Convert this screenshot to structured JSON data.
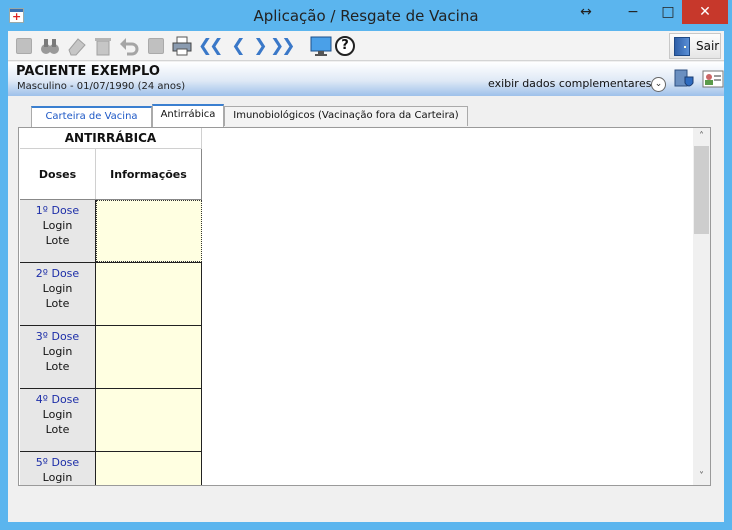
{
  "window": {
    "title": "Aplicação / Resgate de Vacina",
    "controls": {
      "restore": "↔",
      "minimize": "−",
      "maximize": "□",
      "close": "✕"
    }
  },
  "toolbar": {
    "buttons": [
      {
        "name": "new-icon",
        "glyph": ""
      },
      {
        "name": "search-binoculars-icon",
        "glyph": ""
      },
      {
        "name": "eraser-icon",
        "glyph": ""
      },
      {
        "name": "trash-icon",
        "glyph": ""
      },
      {
        "name": "undo-icon",
        "glyph": ""
      },
      {
        "name": "save-icon",
        "glyph": ""
      },
      {
        "name": "print-icon",
        "glyph": ""
      }
    ],
    "nav": {
      "first": "❮❮",
      "prev": "❮",
      "next": "❯",
      "last": "❯❯"
    },
    "help": "?",
    "exit_label": "Sair"
  },
  "patient": {
    "name": "PACIENTE EXEMPLO",
    "info": "Masculino - 01/07/1990 (24 anos)",
    "extra_link": "exibir dados complementares...",
    "expand_glyph": "⌄"
  },
  "tabs": [
    {
      "label": "Carteira de Vacina"
    },
    {
      "label": "Antirrábica"
    },
    {
      "label": "Imunobiológicos (Vacinação fora da Carteira)"
    }
  ],
  "grid": {
    "title": "ANTIRRÁBICA",
    "columns": [
      "Doses",
      "Informações"
    ],
    "rows": [
      {
        "dose": "1º Dose",
        "login": "Login",
        "lote": "Lote"
      },
      {
        "dose": "2º Dose",
        "login": "Login",
        "lote": "Lote"
      },
      {
        "dose": "3º Dose",
        "login": "Login",
        "lote": "Lote"
      },
      {
        "dose": "4º Dose",
        "login": "Login",
        "lote": "Lote"
      },
      {
        "dose": "5º Dose",
        "login": "Login",
        "lote": ""
      }
    ]
  },
  "scrollbar": {
    "up": "˄",
    "down": "˅"
  },
  "colors": {
    "accent": "#3a7fd0",
    "cell_fill": "#ffffe1",
    "dose_label": "#1d2ea8",
    "close": "#c7382b"
  }
}
